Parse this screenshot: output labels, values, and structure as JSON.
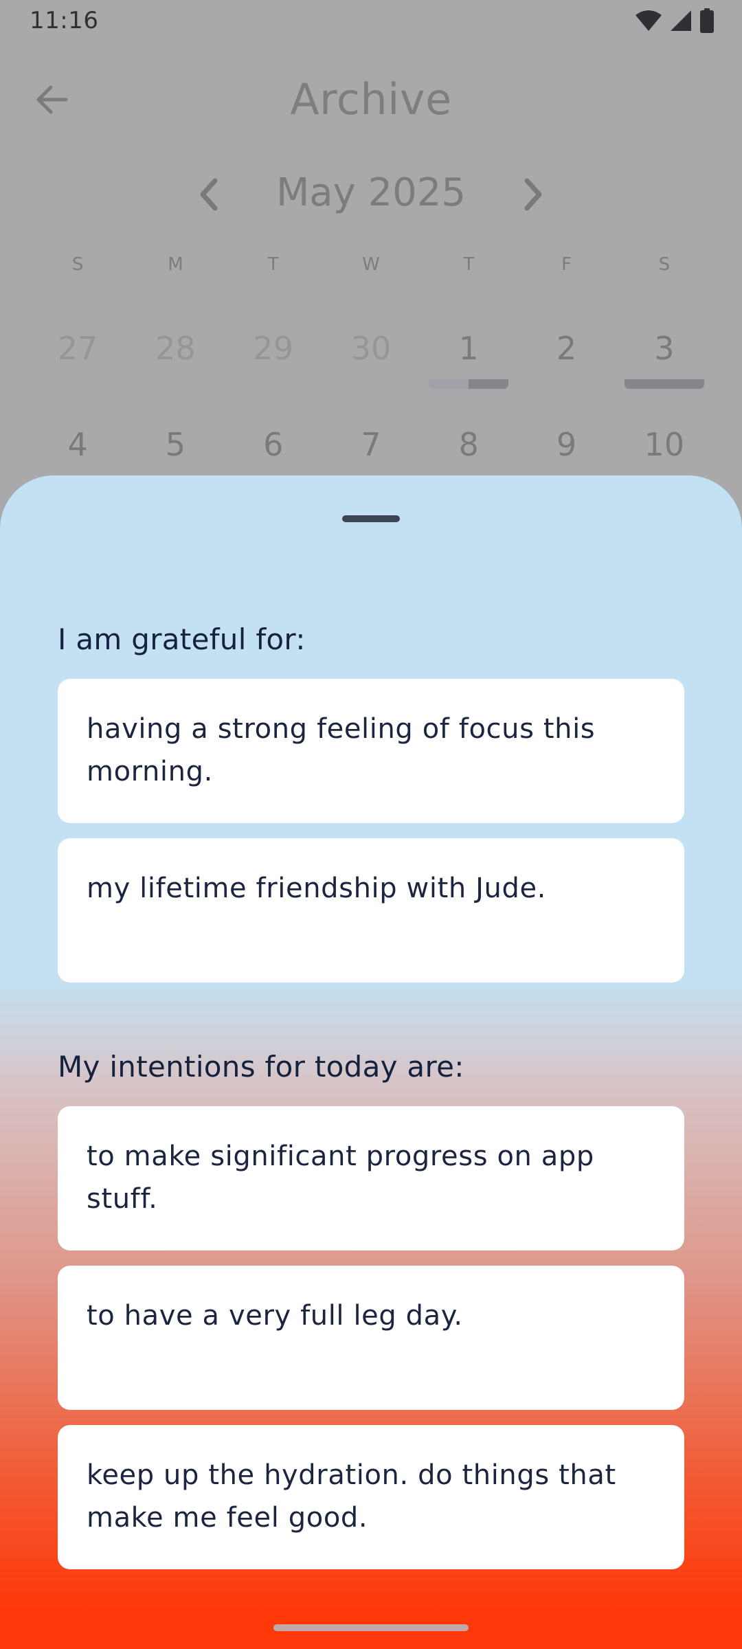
{
  "status_bar": {
    "time": "11:16",
    "icons": [
      "wifi-icon",
      "cellular-signal-icon",
      "battery-icon"
    ]
  },
  "header": {
    "back_icon": "back-arrow-icon",
    "title": "Archive"
  },
  "calendar": {
    "month_label": "May 2025",
    "prev_icon": "chevron-left-icon",
    "next_icon": "chevron-right-icon",
    "weekdays": [
      "S",
      "M",
      "T",
      "W",
      "T",
      "F",
      "S"
    ],
    "weeks": [
      [
        "27",
        "28",
        "29",
        "30",
        "1",
        "2",
        "3"
      ],
      [
        "4",
        "5",
        "6",
        "7",
        "8",
        "9",
        "10"
      ]
    ],
    "entry_progress": {
      "1": 0.5,
      "3": 1.0
    }
  },
  "sheet": {
    "gratitude_title": "I am grateful for:",
    "gratitude_entries": [
      "having a strong feeling of focus this morning.",
      "my lifetime friendship with Jude."
    ],
    "intentions_title": "My intentions for today are:",
    "intention_entries": [
      "to make significant progress on app stuff.",
      "to have a very full leg day.",
      "keep up the hydration. do things that make me feel good."
    ]
  },
  "colors": {
    "sheet_top": "#c3e1f2",
    "sheet_bottom": "#fe3809",
    "card": "#ffffff",
    "text": "#15223d",
    "scrim": "#a9a9ac"
  }
}
